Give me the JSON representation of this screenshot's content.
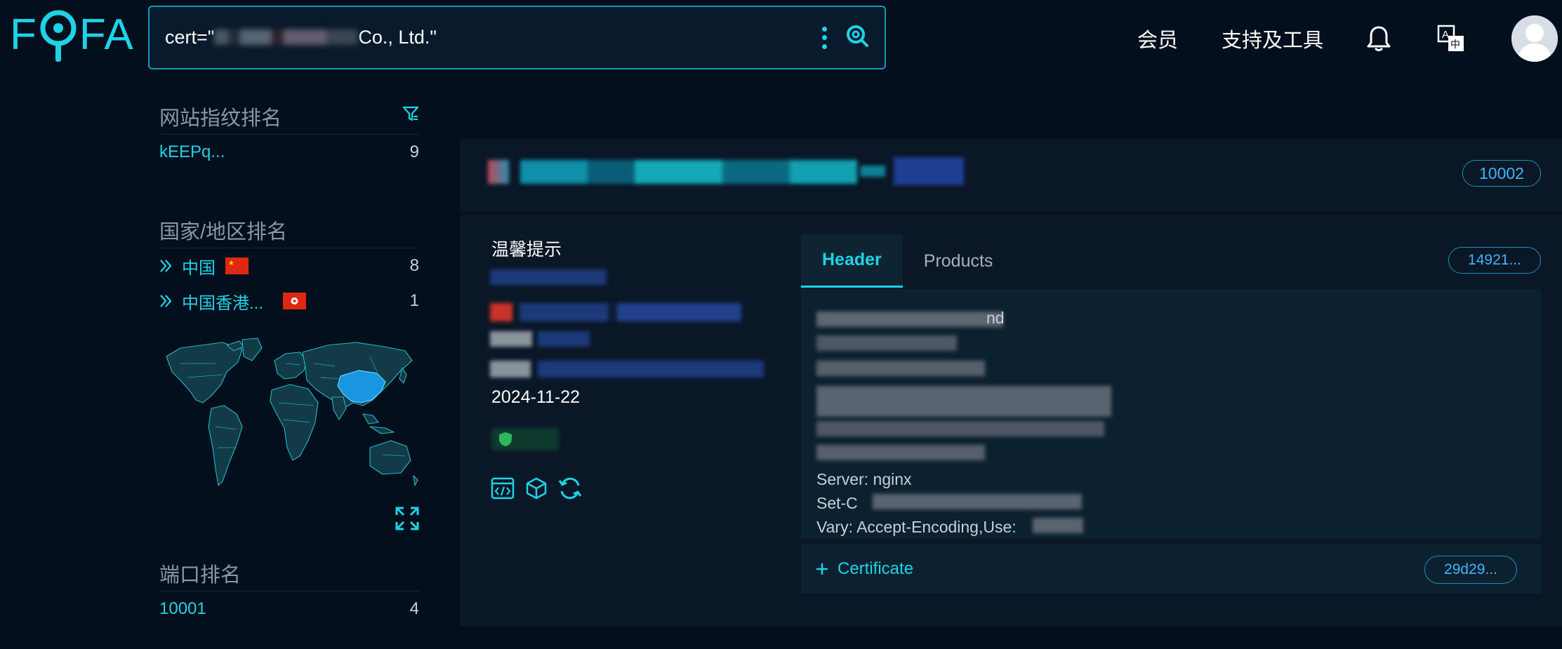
{
  "brand": {
    "logo_text_left": "F",
    "logo_text_right": "FA"
  },
  "search": {
    "query_prefix": "cert=\"",
    "query_suffix": "Co., Ltd.\""
  },
  "topnav": {
    "member": "会员",
    "tools": "支持及工具"
  },
  "sidebar": {
    "fingerprint": {
      "title": "网站指纹排名",
      "items": [
        {
          "label": "kEEPq...",
          "count": "9"
        }
      ]
    },
    "country": {
      "title": "国家/地区排名",
      "items": [
        {
          "label": "中国",
          "count": "8"
        },
        {
          "label": "中国香港...",
          "count": "1"
        }
      ]
    },
    "port": {
      "title": "端口排名",
      "items": [
        {
          "label": "10001",
          "count": "4"
        }
      ]
    }
  },
  "result": {
    "port_badge": "10002",
    "tip_title": "温馨提示",
    "date": "2024-11-22",
    "tabs": [
      "Header",
      "Products"
    ],
    "hash_badge": "14921...",
    "header_lines": {
      "server": "Server: nginx",
      "set_cookie": "Set-C",
      "vary": "Vary: Accept-Encoding,Use:",
      "line1_tail": "nd"
    },
    "certificate": {
      "label": "Certificate",
      "badge": "29d29..."
    }
  },
  "colors": {
    "accent": "#1fd3e6",
    "badge": "#3fb6ff",
    "bg": "#040f1e",
    "card": "#0a1727"
  }
}
